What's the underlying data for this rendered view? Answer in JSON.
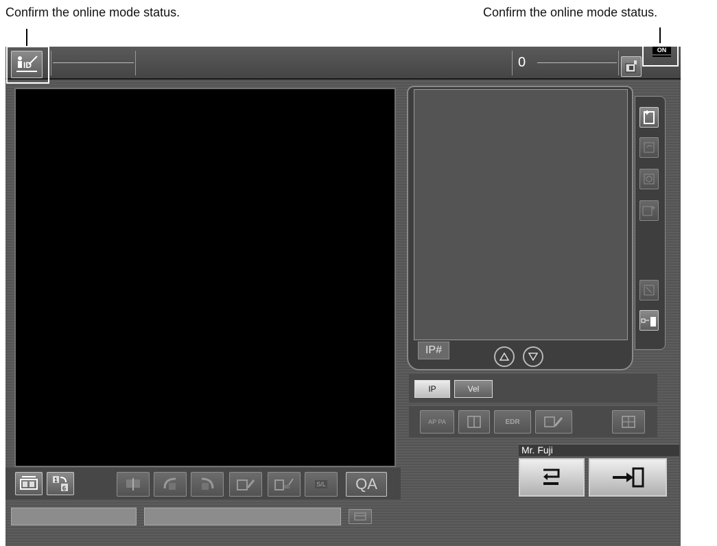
{
  "annotations": {
    "left_text": "Confirm the online mode status.",
    "right_text": "Confirm the online mode status."
  },
  "topbar": {
    "id_button_icon": "patient-id-edit-icon",
    "counter_value": "0",
    "online_badge": "ON"
  },
  "viewer_toolbar": {
    "qa_label": "QA",
    "sl_label": "S/L",
    "page_icon_label": "16"
  },
  "right_panel": {
    "ip_label": "IP#",
    "tabs": [
      {
        "label": "IP",
        "selected": true
      },
      {
        "label": "Vel",
        "selected": false
      }
    ],
    "tool_labels": {
      "ap_pa": "AP PA",
      "edr": "EDR"
    },
    "operator_name": "Mr. Fuji"
  },
  "colors": {
    "background": "#2b2b2b",
    "viewer": "#000000",
    "button_light": "#e0e0e0"
  }
}
